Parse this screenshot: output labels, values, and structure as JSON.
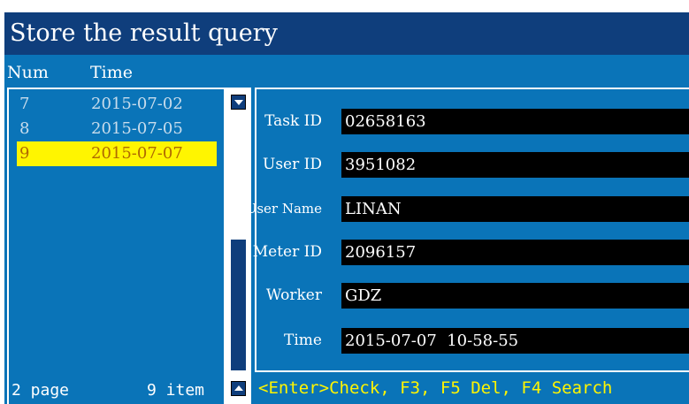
{
  "window": {
    "title": "Store the result query"
  },
  "list": {
    "headers": {
      "num": "Num",
      "time": "Time"
    },
    "rows": [
      {
        "num": "7",
        "time": "2015-07-02"
      },
      {
        "num": "8",
        "time": "2015-07-05"
      },
      {
        "num": "9",
        "time": "2015-07-07"
      }
    ],
    "selected": "9",
    "page_label": "2 page",
    "item_label": "9 item",
    "scroll_up_icon": "triangle-down-icon",
    "scroll_down_icon": "triangle-up-icon"
  },
  "detail": {
    "fields": [
      {
        "label": "Task ID",
        "value": "02658163"
      },
      {
        "label": "User ID",
        "value": "3951082"
      },
      {
        "label": "User Name",
        "value": "LINAN"
      },
      {
        "label": "Meter ID",
        "value": "2096157"
      },
      {
        "label": "Worker",
        "value": "GDZ"
      },
      {
        "label": "Time",
        "value": "2015-07-07  10-58-55"
      }
    ]
  },
  "status": {
    "hint": "<Enter>Check, F3, F5 Del, F4 Search"
  },
  "colors": {
    "background": "#0a74b8",
    "titlebar": "#0f3e7c",
    "highlight": "#fff500",
    "field": "#000000"
  }
}
